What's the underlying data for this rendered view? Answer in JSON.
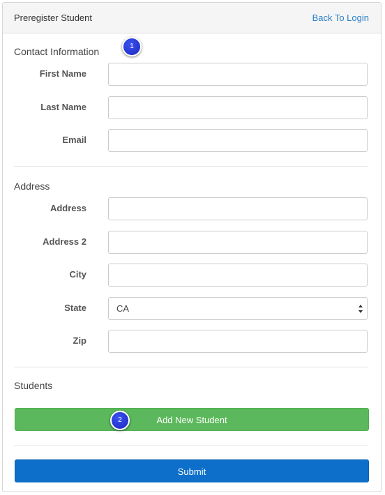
{
  "header": {
    "title": "Preregister Student",
    "back_link": "Back To Login"
  },
  "contact": {
    "title": "Contact Information",
    "first_name_label": "First Name",
    "last_name_label": "Last Name",
    "email_label": "Email",
    "first_name_value": "",
    "last_name_value": "",
    "email_value": ""
  },
  "address": {
    "title": "Address",
    "address_label": "Address",
    "address2_label": "Address 2",
    "city_label": "City",
    "state_label": "State",
    "state_value": "CA",
    "zip_label": "Zip",
    "address_value": "",
    "address2_value": "",
    "city_value": "",
    "zip_value": ""
  },
  "students": {
    "title": "Students",
    "add_button": "Add New Student"
  },
  "submit_label": "Submit",
  "badges": {
    "one": "1",
    "two": "2"
  },
  "colors": {
    "link": "#2a7fc9",
    "add_button": "#5cb85c",
    "submit_button": "#0d6fc9",
    "badge": "#1a27c0"
  }
}
